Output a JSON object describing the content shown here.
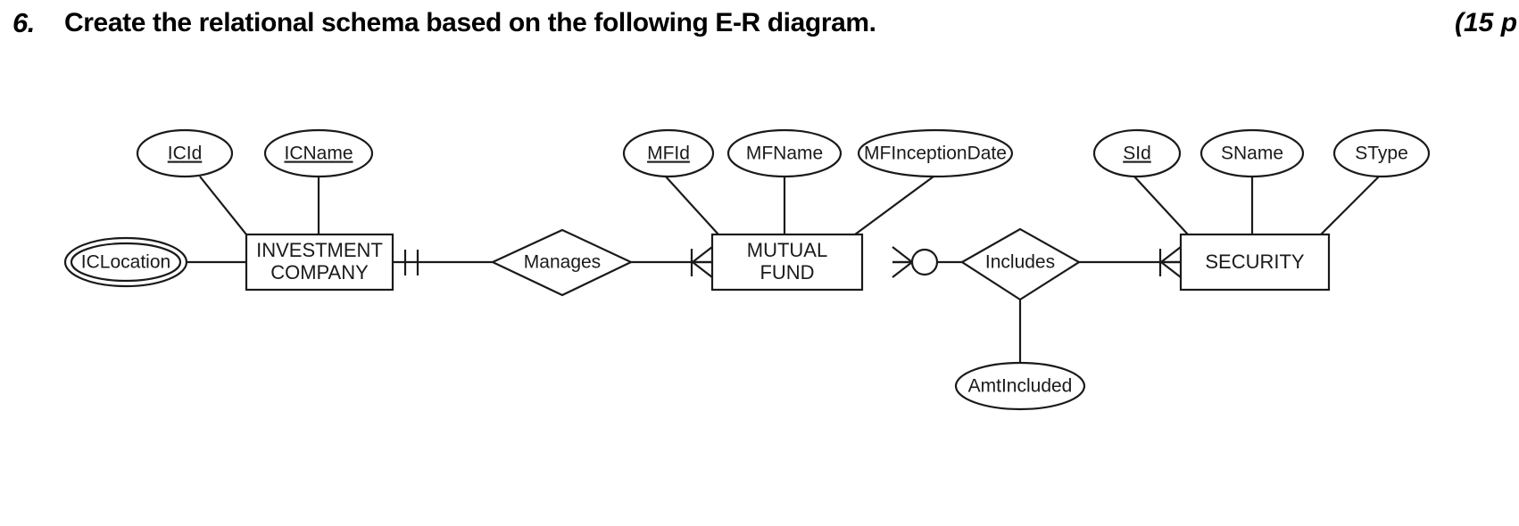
{
  "header": {
    "number": "6.",
    "text": "Create the relational schema based on the following E-R diagram.",
    "points": "(15 p"
  },
  "diagram": {
    "type": "er-diagram",
    "entities": [
      {
        "id": "investment_company",
        "label_line1": "INVESTMENT",
        "label_line2": "COMPANY"
      },
      {
        "id": "mutual_fund",
        "label_line1": "MUTUAL",
        "label_line2": "FUND"
      },
      {
        "id": "security",
        "label_line1": "SECURITY",
        "label_line2": ""
      }
    ],
    "relationships": [
      {
        "id": "manages",
        "label": "Manages"
      },
      {
        "id": "includes",
        "label": "Includes"
      }
    ],
    "attributes": [
      {
        "id": "icid",
        "label": "ICId",
        "owner": "investment_company",
        "key": true,
        "multivalued": false
      },
      {
        "id": "icname",
        "label": "ICName",
        "owner": "investment_company",
        "key": true,
        "multivalued": false
      },
      {
        "id": "iclocation",
        "label": "ICLocation",
        "owner": "investment_company",
        "key": false,
        "multivalued": true
      },
      {
        "id": "mfid",
        "label": "MFId",
        "owner": "mutual_fund",
        "key": true,
        "multivalued": false
      },
      {
        "id": "mfname",
        "label": "MFName",
        "owner": "mutual_fund",
        "key": false,
        "multivalued": false
      },
      {
        "id": "mfinceptiondate",
        "label": "MFInceptionDate",
        "owner": "mutual_fund",
        "key": false,
        "multivalued": false
      },
      {
        "id": "sid",
        "label": "SId",
        "owner": "security",
        "key": true,
        "multivalued": false
      },
      {
        "id": "sname",
        "label": "SName",
        "owner": "security",
        "key": false,
        "multivalued": false
      },
      {
        "id": "stype",
        "label": "SType",
        "owner": "security",
        "key": false,
        "multivalued": false
      },
      {
        "id": "amtincluded",
        "label": "AmtIncluded",
        "owner": "includes",
        "key": false,
        "multivalued": false
      }
    ],
    "cardinalities": [
      {
        "id": "ic_manages",
        "notation": "one-mandatory",
        "symbol": "||"
      },
      {
        "id": "manages_mf",
        "notation": "many-mandatory",
        "symbol": "crowsfoot-bar"
      },
      {
        "id": "mf_includes",
        "notation": "many-optional",
        "symbol": "crowsfoot-circle"
      },
      {
        "id": "includes_security",
        "notation": "many-mandatory",
        "symbol": "crowsfoot-bar"
      }
    ],
    "colors": {
      "stroke": "#1a1a1a",
      "fill": "#ffffff",
      "background": "#ffffff"
    }
  }
}
